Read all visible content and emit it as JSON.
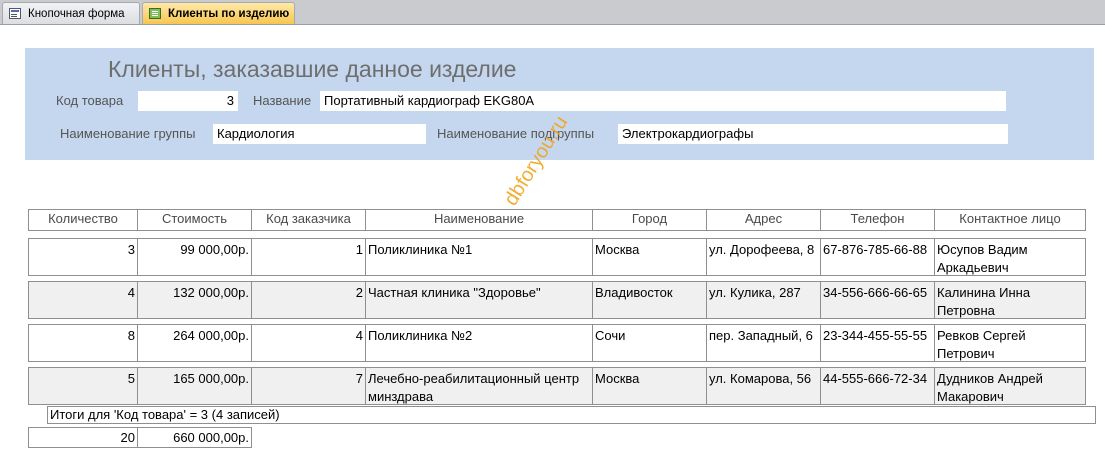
{
  "tabs": [
    {
      "label": "Кнопочная форма",
      "icon": "form-icon",
      "active": false
    },
    {
      "label": "Клиенты по изделию",
      "icon": "report-icon",
      "active": true
    }
  ],
  "header": {
    "title": "Клиенты, заказавшие данное изделие",
    "product_code_label": "Код товара",
    "product_code_value": "3",
    "name_label": "Название",
    "name_value": "Портативный кардиограф EKG80A",
    "group_label": "Наименование группы",
    "group_value": "Кардиология",
    "subgroup_label": "Наименование подгруппы",
    "subgroup_value": "Электрокардиографы"
  },
  "table": {
    "columns": [
      "Количество",
      "Стоимость",
      "Код заказчика",
      "Наименование",
      "Город",
      "Адрес",
      "Телефон",
      "Контактное лицо"
    ],
    "rows": [
      {
        "qty": "3",
        "cost": "99 000,00р.",
        "client_id": "1",
        "name": "Поликлиника №1",
        "city": "Москва",
        "address": "ул. Дорофеева, 8",
        "phone": "67-876-785-66-88",
        "contact": "Юсупов Вадим Аркадьевич"
      },
      {
        "qty": "4",
        "cost": "132 000,00р.",
        "client_id": "2",
        "name": "Частная клиника \"Здоровье\"",
        "city": "Владивосток",
        "address": "ул. Кулика, 287",
        "phone": "34-556-666-66-65",
        "contact": "Калинина Инна Петровна"
      },
      {
        "qty": "8",
        "cost": "264 000,00р.",
        "client_id": "4",
        "name": "Поликлиника №2",
        "city": "Сочи",
        "address": "пер. Западный, 6",
        "phone": "23-344-455-55-55",
        "contact": "Ревков Сергей Петрович"
      },
      {
        "qty": "5",
        "cost": "165 000,00р.",
        "client_id": "7",
        "name": "Лечебно-реабилитационный центр минздрава",
        "city": "Москва",
        "address": "ул. Комарова, 56",
        "phone": "44-555-666-72-34",
        "contact": "Дудников Андрей Макарович"
      }
    ]
  },
  "totals": {
    "label": "Итоги для 'Код товара' =  3 (4 записей)",
    "qty": "20",
    "cost": "660 000,00р."
  },
  "watermark": "dbforyou.ru"
}
